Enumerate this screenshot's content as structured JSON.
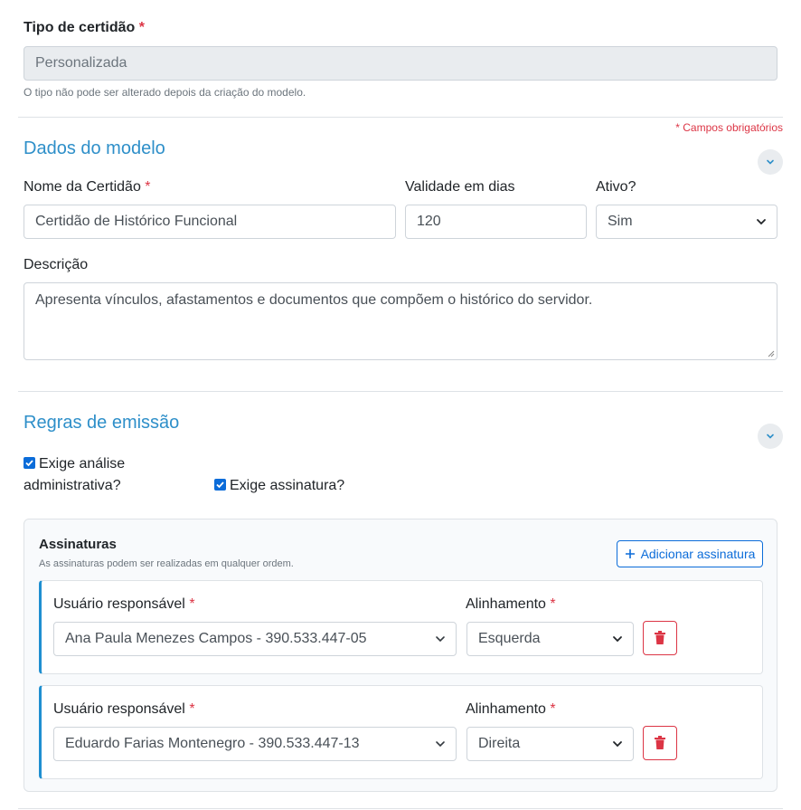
{
  "tipo": {
    "label": "Tipo de certidão",
    "required_mark": "*",
    "value": "Personalizada",
    "help": "O tipo não pode ser alterado depois da criação do modelo."
  },
  "required_note": "* Campos obrigatórios",
  "dados_modelo": {
    "title": "Dados do modelo",
    "nome": {
      "label": "Nome da Certidão",
      "required_mark": "*",
      "value": "Certidão de Histórico Funcional"
    },
    "validade": {
      "label": "Validade em dias",
      "value": "120"
    },
    "ativo": {
      "label": "Ativo?",
      "value": "Sim"
    },
    "descricao": {
      "label": "Descrição",
      "value": "Apresenta vínculos, afastamentos e documentos que compõem o histórico do servidor."
    }
  },
  "regras": {
    "title": "Regras de emissão",
    "analise_line1": "Exige análise",
    "analise_line2": "administrativa?",
    "assinatura_check": "Exige assinatura?"
  },
  "assinaturas": {
    "title": "Assinaturas",
    "subtitle": "As assinaturas podem ser realizadas em qualquer ordem.",
    "add_button": "Adicionar assinatura",
    "rows": [
      {
        "usuario_label": "Usuário responsável",
        "usuario_value": "Ana Paula Menezes Campos - 390.533.447-05",
        "alinhamento_label": "Alinhamento",
        "alinhamento_value": "Esquerda"
      },
      {
        "usuario_label": "Usuário responsável",
        "usuario_value": "Eduardo Farias Montenegro - 390.533.447-13",
        "alinhamento_label": "Alinhamento",
        "alinhamento_value": "Direita"
      }
    ],
    "required_mark": "*"
  },
  "colors": {
    "accent": "#2e8fc9",
    "primary": "#0b6cd9",
    "danger": "#dc3545"
  }
}
